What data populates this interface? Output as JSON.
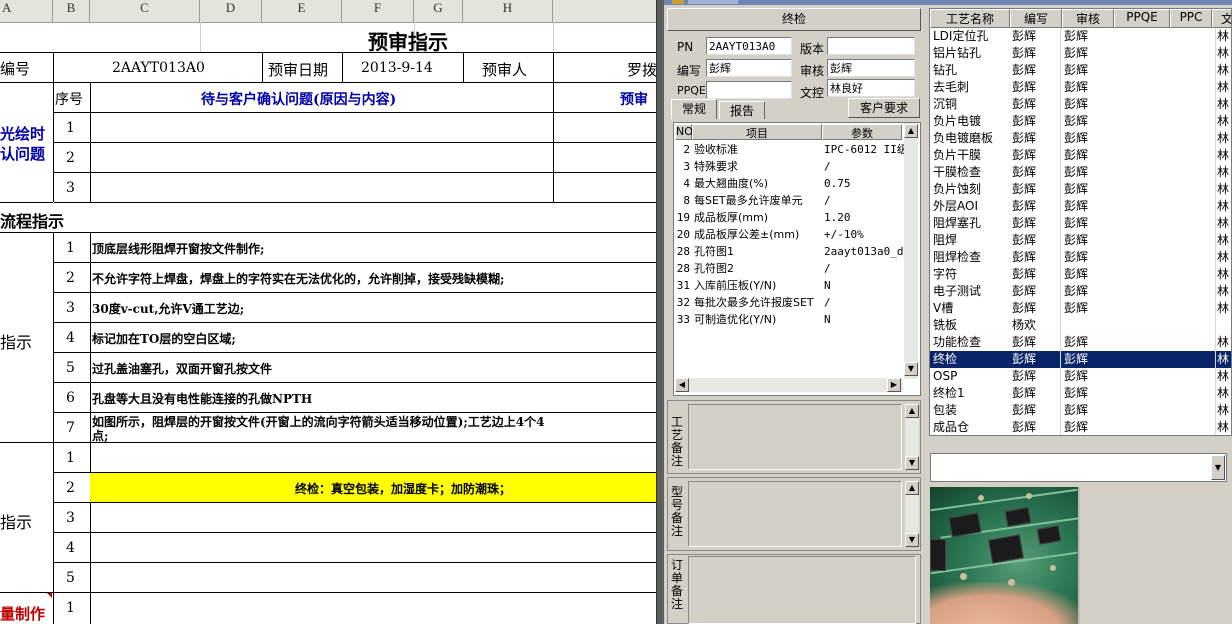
{
  "sheet": {
    "columns": [
      "A",
      "B",
      "C",
      "D",
      "E",
      "F",
      "G",
      "H"
    ],
    "title": "预审指示",
    "row2": {
      "label_no": "编号",
      "pn": "2AAYT013A0",
      "label_date": "预审日期",
      "date": "2013-9-14",
      "label_reviewer": "预审人",
      "reviewer": "罗拨"
    },
    "row3": {
      "seq_header": "序号",
      "issue_header": "待与客户确认问题(原因与内容)",
      "right_header": "预审"
    },
    "section1_label": "光绘时\n认问题",
    "section1_nums": [
      "1",
      "2",
      "3"
    ],
    "flow_label": "流程指示",
    "section2_label": "指示",
    "section2_items": [
      {
        "n": "1",
        "text": "顶底层线形阻焊开窗按文件制作;"
      },
      {
        "n": "2",
        "text": "不允许字符上焊盘，焊盘上的字符实在无法优化的，允许削掉，接受残缺模糊;"
      },
      {
        "n": "3",
        "text": "30度v-cut,允许V通工艺边;"
      },
      {
        "n": "4",
        "text": "标记加在TO层的空白区域;"
      },
      {
        "n": "5",
        "text": "过孔盖油塞孔，双面开窗孔按文件"
      },
      {
        "n": "6",
        "text": "孔盘等大且没有电性能连接的孔做NPTH"
      },
      {
        "n": "7",
        "text": "如图所示，阻焊层的开窗按文件(开窗上的流向字符箭头适当移动位置);工艺边上4个4",
        "text2": "点;"
      }
    ],
    "section3_label": "指示",
    "section3_nums": [
      "1",
      "2",
      "3",
      "4",
      "5"
    ],
    "section3_highlight": "终检：真空包装，加湿度卡；加防潮珠；",
    "section4_label": "量制作",
    "section4_num": "1"
  },
  "form": {
    "header": "终检",
    "pn_label": "PN",
    "pn": "2AAYT013A0",
    "version_label": "版本",
    "version": "",
    "author_label": "编写",
    "author": "彭辉",
    "review_label": "审核",
    "review": "彭辉",
    "ppqe_label": "PPQE",
    "ppqe": "",
    "control_label": "文控",
    "control": "林良好",
    "tabs": [
      "常规",
      "报告"
    ],
    "customer_btn": "客户要求",
    "grid_headers": {
      "no": "NO",
      "item": "项目",
      "param": "参数"
    },
    "grid_rows": [
      {
        "no": "2",
        "item": "验收标准",
        "param": "IPC-6012 II级"
      },
      {
        "no": "3",
        "item": "特殊要求",
        "param": "/"
      },
      {
        "no": "4",
        "item": "最大翘曲度(%)",
        "param": "0.75"
      },
      {
        "no": "8",
        "item": "每SET最多允许废单元",
        "param": "/"
      },
      {
        "no": "19",
        "item": "成品板厚(mm)",
        "param": "1.20"
      },
      {
        "no": "20",
        "item": "成品板厚公差±(mm)",
        "param": "+/-10%"
      },
      {
        "no": "28",
        "item": "孔符图1",
        "param": "2aayt013a0_dr"
      },
      {
        "no": "28",
        "item": "孔符图2",
        "param": "/"
      },
      {
        "no": "31",
        "item": "入库前压板(Y/N)",
        "param": "N"
      },
      {
        "no": "32",
        "item": "每批次最多允许报废SET",
        "param": "/"
      },
      {
        "no": "33",
        "item": "可制造优化(Y/N)",
        "param": "N"
      }
    ],
    "memo1": "工艺备注",
    "memo2": "型号备注",
    "memo3": "订单备注"
  },
  "process": {
    "headers": [
      "工艺名称",
      "编写",
      "审核",
      "PPQE",
      "PPC",
      "文"
    ],
    "rows": [
      {
        "name": "LDI定位孔",
        "author": "彭辉",
        "review": "彭辉",
        "c": "林"
      },
      {
        "name": "铝片钻孔",
        "author": "彭辉",
        "review": "彭辉",
        "c": "林"
      },
      {
        "name": "钻孔",
        "author": "彭辉",
        "review": "彭辉",
        "c": "林"
      },
      {
        "name": "去毛刺",
        "author": "彭辉",
        "review": "彭辉",
        "c": "林"
      },
      {
        "name": "沉铜",
        "author": "彭辉",
        "review": "彭辉",
        "c": "林"
      },
      {
        "name": "负片电镀",
        "author": "彭辉",
        "review": "彭辉",
        "c": "林"
      },
      {
        "name": "负电镀磨板",
        "author": "彭辉",
        "review": "彭辉",
        "c": "林"
      },
      {
        "name": "负片干膜",
        "author": "彭辉",
        "review": "彭辉",
        "c": "林"
      },
      {
        "name": "干膜检查",
        "author": "彭辉",
        "review": "彭辉",
        "c": "林"
      },
      {
        "name": "负片蚀刻",
        "author": "彭辉",
        "review": "彭辉",
        "c": "林"
      },
      {
        "name": "外层AOI",
        "author": "彭辉",
        "review": "彭辉",
        "c": "林"
      },
      {
        "name": "阻焊塞孔",
        "author": "彭辉",
        "review": "彭辉",
        "c": "林"
      },
      {
        "name": "阻焊",
        "author": "彭辉",
        "review": "彭辉",
        "c": "林"
      },
      {
        "name": "阻焊检查",
        "author": "彭辉",
        "review": "彭辉",
        "c": "林"
      },
      {
        "name": "字符",
        "author": "彭辉",
        "review": "彭辉",
        "c": "林"
      },
      {
        "name": "电子测试",
        "author": "彭辉",
        "review": "彭辉",
        "c": "林"
      },
      {
        "name": "V槽",
        "author": "彭辉",
        "review": "彭辉",
        "c": "林"
      },
      {
        "name": "铣板",
        "author": "杨欢",
        "review": "",
        "c": ""
      },
      {
        "name": "功能检查",
        "author": "彭辉",
        "review": "彭辉",
        "c": "林"
      },
      {
        "name": "终检",
        "author": "彭辉",
        "review": "彭辉",
        "c": "林",
        "selected": true
      },
      {
        "name": "OSP",
        "author": "彭辉",
        "review": "彭辉",
        "c": "林"
      },
      {
        "name": "终检1",
        "author": "彭辉",
        "review": "彭辉",
        "c": "林"
      },
      {
        "name": "包装",
        "author": "彭辉",
        "review": "彭辉",
        "c": "林"
      },
      {
        "name": "成品仓",
        "author": "彭辉",
        "review": "彭辉",
        "c": "林"
      }
    ],
    "combo_value": ""
  },
  "colors": {
    "selection": "#0a246a",
    "highlight": "#ffff00",
    "accent_blue": "#0000a8",
    "accent_red": "#c00000"
  }
}
